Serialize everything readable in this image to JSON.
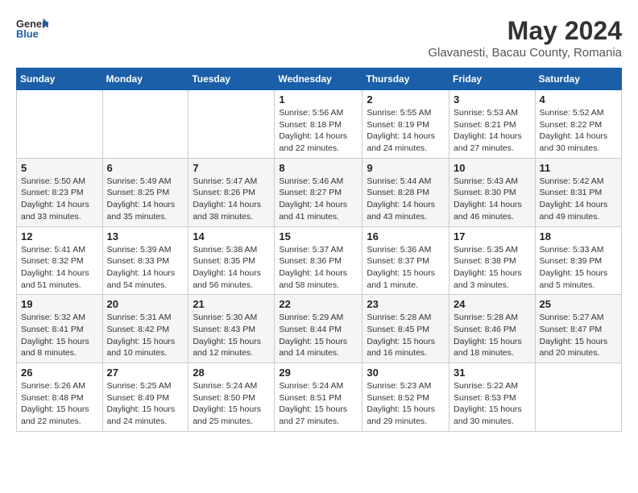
{
  "header": {
    "logo_general": "General",
    "logo_blue": "Blue",
    "month_title": "May 2024",
    "location": "Glavanesti, Bacau County, Romania"
  },
  "days_of_week": [
    "Sunday",
    "Monday",
    "Tuesday",
    "Wednesday",
    "Thursday",
    "Friday",
    "Saturday"
  ],
  "weeks": [
    [
      {
        "day": "",
        "info": ""
      },
      {
        "day": "",
        "info": ""
      },
      {
        "day": "",
        "info": ""
      },
      {
        "day": "1",
        "info": "Sunrise: 5:56 AM\nSunset: 8:18 PM\nDaylight: 14 hours\nand 22 minutes."
      },
      {
        "day": "2",
        "info": "Sunrise: 5:55 AM\nSunset: 8:19 PM\nDaylight: 14 hours\nand 24 minutes."
      },
      {
        "day": "3",
        "info": "Sunrise: 5:53 AM\nSunset: 8:21 PM\nDaylight: 14 hours\nand 27 minutes."
      },
      {
        "day": "4",
        "info": "Sunrise: 5:52 AM\nSunset: 8:22 PM\nDaylight: 14 hours\nand 30 minutes."
      }
    ],
    [
      {
        "day": "5",
        "info": "Sunrise: 5:50 AM\nSunset: 8:23 PM\nDaylight: 14 hours\nand 33 minutes."
      },
      {
        "day": "6",
        "info": "Sunrise: 5:49 AM\nSunset: 8:25 PM\nDaylight: 14 hours\nand 35 minutes."
      },
      {
        "day": "7",
        "info": "Sunrise: 5:47 AM\nSunset: 8:26 PM\nDaylight: 14 hours\nand 38 minutes."
      },
      {
        "day": "8",
        "info": "Sunrise: 5:46 AM\nSunset: 8:27 PM\nDaylight: 14 hours\nand 41 minutes."
      },
      {
        "day": "9",
        "info": "Sunrise: 5:44 AM\nSunset: 8:28 PM\nDaylight: 14 hours\nand 43 minutes."
      },
      {
        "day": "10",
        "info": "Sunrise: 5:43 AM\nSunset: 8:30 PM\nDaylight: 14 hours\nand 46 minutes."
      },
      {
        "day": "11",
        "info": "Sunrise: 5:42 AM\nSunset: 8:31 PM\nDaylight: 14 hours\nand 49 minutes."
      }
    ],
    [
      {
        "day": "12",
        "info": "Sunrise: 5:41 AM\nSunset: 8:32 PM\nDaylight: 14 hours\nand 51 minutes."
      },
      {
        "day": "13",
        "info": "Sunrise: 5:39 AM\nSunset: 8:33 PM\nDaylight: 14 hours\nand 54 minutes."
      },
      {
        "day": "14",
        "info": "Sunrise: 5:38 AM\nSunset: 8:35 PM\nDaylight: 14 hours\nand 56 minutes."
      },
      {
        "day": "15",
        "info": "Sunrise: 5:37 AM\nSunset: 8:36 PM\nDaylight: 14 hours\nand 58 minutes."
      },
      {
        "day": "16",
        "info": "Sunrise: 5:36 AM\nSunset: 8:37 PM\nDaylight: 15 hours\nand 1 minute."
      },
      {
        "day": "17",
        "info": "Sunrise: 5:35 AM\nSunset: 8:38 PM\nDaylight: 15 hours\nand 3 minutes."
      },
      {
        "day": "18",
        "info": "Sunrise: 5:33 AM\nSunset: 8:39 PM\nDaylight: 15 hours\nand 5 minutes."
      }
    ],
    [
      {
        "day": "19",
        "info": "Sunrise: 5:32 AM\nSunset: 8:41 PM\nDaylight: 15 hours\nand 8 minutes."
      },
      {
        "day": "20",
        "info": "Sunrise: 5:31 AM\nSunset: 8:42 PM\nDaylight: 15 hours\nand 10 minutes."
      },
      {
        "day": "21",
        "info": "Sunrise: 5:30 AM\nSunset: 8:43 PM\nDaylight: 15 hours\nand 12 minutes."
      },
      {
        "day": "22",
        "info": "Sunrise: 5:29 AM\nSunset: 8:44 PM\nDaylight: 15 hours\nand 14 minutes."
      },
      {
        "day": "23",
        "info": "Sunrise: 5:28 AM\nSunset: 8:45 PM\nDaylight: 15 hours\nand 16 minutes."
      },
      {
        "day": "24",
        "info": "Sunrise: 5:28 AM\nSunset: 8:46 PM\nDaylight: 15 hours\nand 18 minutes."
      },
      {
        "day": "25",
        "info": "Sunrise: 5:27 AM\nSunset: 8:47 PM\nDaylight: 15 hours\nand 20 minutes."
      }
    ],
    [
      {
        "day": "26",
        "info": "Sunrise: 5:26 AM\nSunset: 8:48 PM\nDaylight: 15 hours\nand 22 minutes."
      },
      {
        "day": "27",
        "info": "Sunrise: 5:25 AM\nSunset: 8:49 PM\nDaylight: 15 hours\nand 24 minutes."
      },
      {
        "day": "28",
        "info": "Sunrise: 5:24 AM\nSunset: 8:50 PM\nDaylight: 15 hours\nand 25 minutes."
      },
      {
        "day": "29",
        "info": "Sunrise: 5:24 AM\nSunset: 8:51 PM\nDaylight: 15 hours\nand 27 minutes."
      },
      {
        "day": "30",
        "info": "Sunrise: 5:23 AM\nSunset: 8:52 PM\nDaylight: 15 hours\nand 29 minutes."
      },
      {
        "day": "31",
        "info": "Sunrise: 5:22 AM\nSunset: 8:53 PM\nDaylight: 15 hours\nand 30 minutes."
      },
      {
        "day": "",
        "info": ""
      }
    ]
  ]
}
